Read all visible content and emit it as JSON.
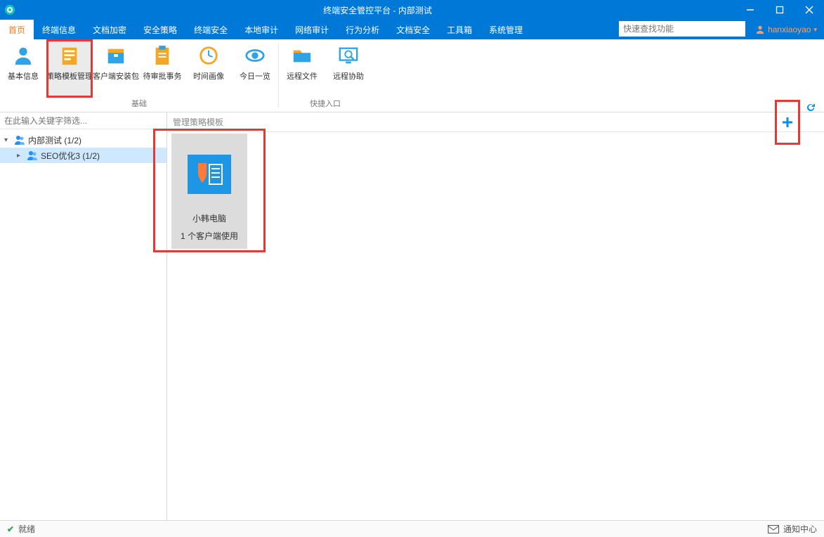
{
  "window": {
    "title": "终端安全管控平台 - 内部测试",
    "user": "hanxiaoyao"
  },
  "menu": {
    "tabs": [
      "首页",
      "终端信息",
      "文档加密",
      "安全策略",
      "终端安全",
      "本地审计",
      "网络审计",
      "行为分析",
      "文档安全",
      "工具箱",
      "系统管理"
    ],
    "active_index": 0,
    "search_placeholder": "快速查找功能"
  },
  "ribbon": {
    "groups": [
      {
        "label": "基础",
        "items": [
          {
            "label": "基本信息",
            "icon": "person"
          },
          {
            "label": "策略模板管理",
            "icon": "template",
            "selected": true,
            "highlighted": true
          },
          {
            "label": "客户端安装包",
            "icon": "box"
          },
          {
            "label": "待审批事务",
            "icon": "clipboard"
          },
          {
            "label": "时间画像",
            "icon": "clock"
          },
          {
            "label": "今日一览",
            "icon": "eye"
          }
        ]
      },
      {
        "label": "快捷入口",
        "items": [
          {
            "label": "远程文件",
            "icon": "folder"
          },
          {
            "label": "远程协助",
            "icon": "screen"
          }
        ]
      }
    ]
  },
  "sidebar": {
    "filter_placeholder": "在此输入关键字筛选...",
    "nodes": [
      {
        "label": "内部测试 (1/2)",
        "level": 0,
        "expanded": true
      },
      {
        "label": "SEO优化3 (1/2)",
        "level": 1,
        "selected": true
      }
    ]
  },
  "content": {
    "title": "管理策略模板",
    "card": {
      "name": "小韩电脑",
      "usage": "1 个客户端使用"
    }
  },
  "status": {
    "left": "就绪",
    "right": "通知中心"
  }
}
